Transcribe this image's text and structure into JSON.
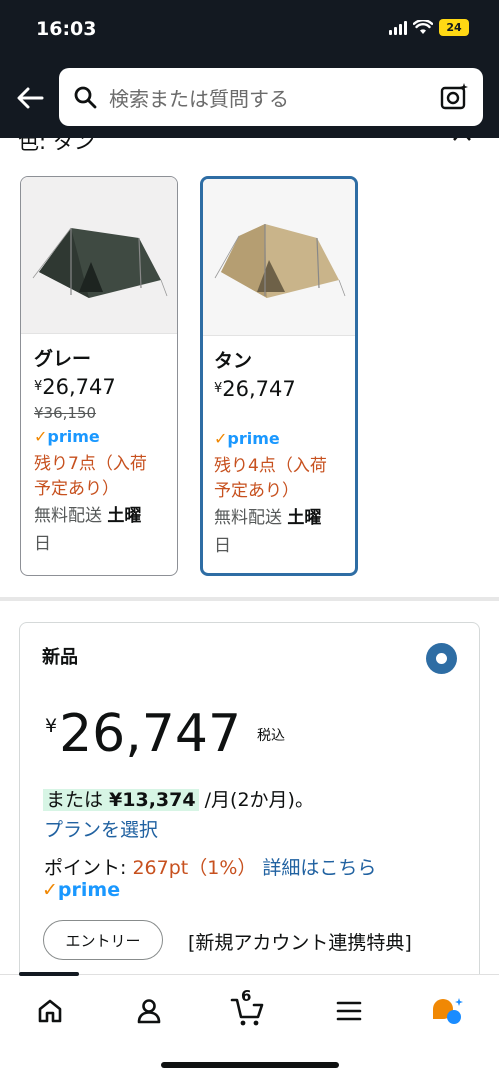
{
  "status_bar": {
    "time": "16:03",
    "battery": "24"
  },
  "header": {
    "search_placeholder": "検索または質問する"
  },
  "color_section": {
    "label": "色: タン",
    "swatches": [
      {
        "name": "グレー",
        "price_symbol": "¥",
        "price": "26,747",
        "list_price": "¥36,150",
        "prime_check": "✓",
        "prime": "prime",
        "stock_line1": "残り7点（入荷",
        "stock_line2": "予定あり）",
        "ship_prefix": "無料配送 ",
        "ship_day": "土曜",
        "ship_suffix": "日",
        "tent_color": "#3f4a42"
      },
      {
        "name": "タン",
        "price_symbol": "¥",
        "price": "26,747",
        "prime_check": "✓",
        "prime": "prime",
        "stock_line1": "残り4点（入荷",
        "stock_line2": "予定あり）",
        "ship_prefix": "無料配送 ",
        "ship_day": "土曜",
        "ship_suffix": "日",
        "tent_color": "#c9b48a"
      }
    ]
  },
  "offer": {
    "title": "新品",
    "price_symbol": "¥",
    "price": "26,747",
    "tax": "税込",
    "installment_prefix": "または ",
    "installment_amount": "¥13,374",
    "installment_suffix": " /月(2か月)。",
    "plan_link": "プランを選択",
    "points_label": "ポイント: ",
    "points_value": "267pt（1%）",
    "points_link": "詳細はこちら",
    "prime_check": "✓",
    "prime": "prime",
    "entry_button": "エントリー",
    "entry_text": "[新規アカウント連携特典]"
  },
  "bottom_nav": {
    "cart_count": "6"
  },
  "colors": {
    "header_bg": "#131921",
    "link": "#2162a1",
    "selected": "#2e6da4",
    "stock": "#c7511f",
    "prime": "#1a98ff"
  }
}
